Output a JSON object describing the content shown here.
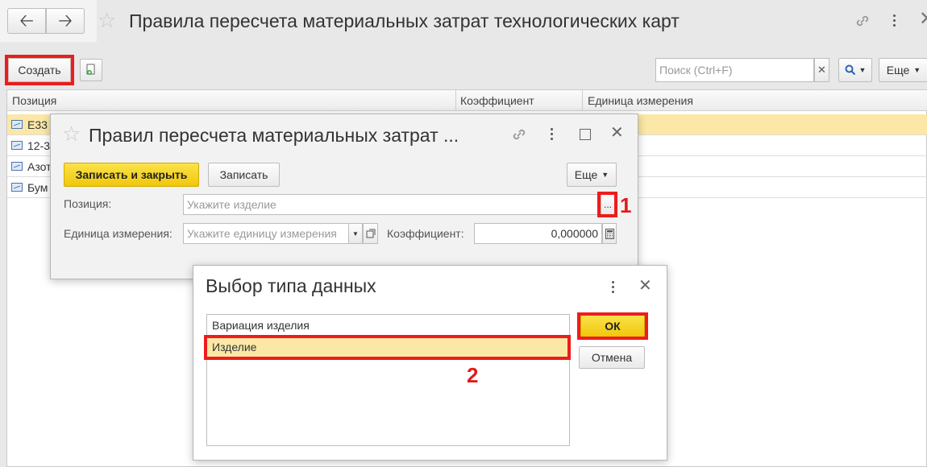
{
  "window": {
    "title": "Правила пересчета материальных затрат технологических карт"
  },
  "toolbar": {
    "create_label": "Создать",
    "search_placeholder": "Поиск (Ctrl+F)",
    "more_label": "Еще"
  },
  "table": {
    "columns": [
      "Позиция",
      "Коэффициент",
      "Единица измерения"
    ],
    "rows": [
      {
        "position": "Е33"
      },
      {
        "position": "12-3"
      },
      {
        "position": "Азот"
      },
      {
        "position": "Бум"
      }
    ]
  },
  "form": {
    "title": "Правил пересчета материальных затрат ...",
    "save_close_label": "Записать и закрыть",
    "save_label": "Записать",
    "more_label": "Еще",
    "position_label": "Позиция:",
    "position_placeholder": "Укажите изделие",
    "unit_label": "Единица измерения:",
    "unit_placeholder": "Укажите единицу измерения",
    "coef_label": "Коэффициент:",
    "coef_value": "0,000000",
    "ellipsis": "...",
    "annotation_1": "1"
  },
  "type_dialog": {
    "title": "Выбор типа данных",
    "options": [
      "Вариация изделия",
      "Изделие"
    ],
    "selected": "Изделие",
    "ok_label": "ОК",
    "cancel_label": "Отмена",
    "annotation_2": "2"
  },
  "colors": {
    "accent_yellow": "#f5d21c",
    "selected_row": "#fbe8a6",
    "annotation_red": "#ee1c1c"
  }
}
